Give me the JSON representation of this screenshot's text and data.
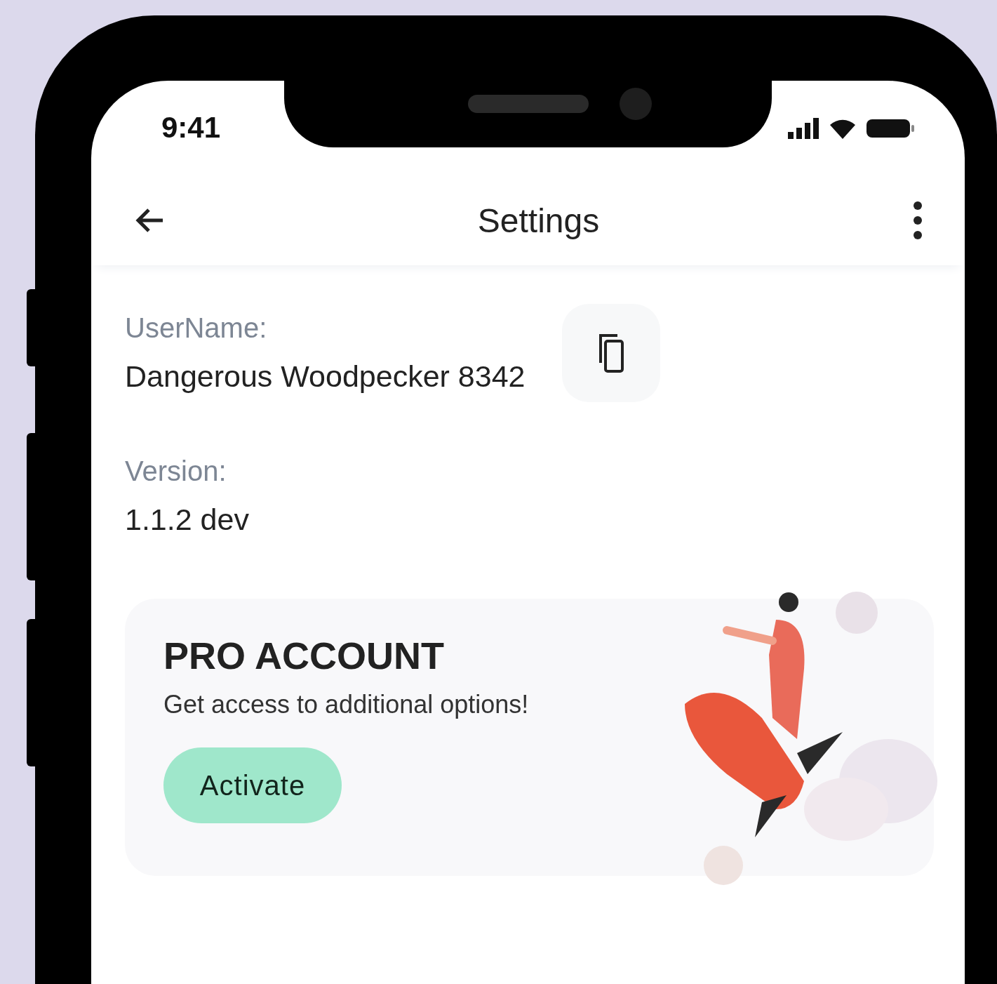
{
  "status_bar": {
    "time": "9:41"
  },
  "header": {
    "title": "Settings"
  },
  "fields": [
    {
      "label": "UserName:",
      "value": "Dangerous Woodpecker 8342",
      "copyable": true
    },
    {
      "label": "Version:",
      "value": "1.1.2 dev",
      "copyable": false
    }
  ],
  "promo": {
    "title": "PRO ACCOUNT",
    "subtitle": "Get access to additional options!",
    "button": "Activate"
  }
}
